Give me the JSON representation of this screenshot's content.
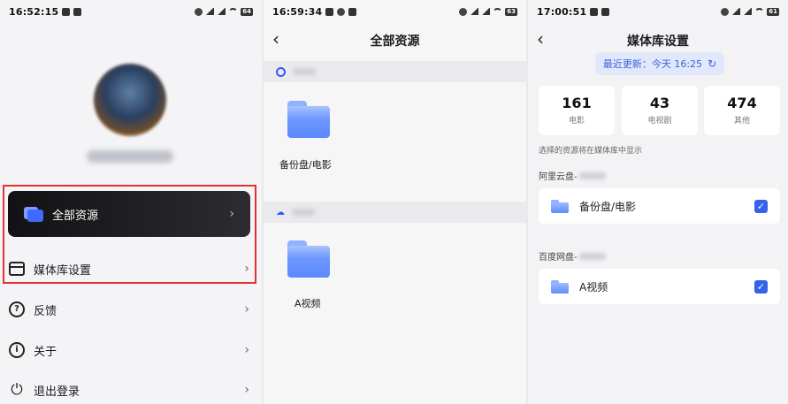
{
  "screen1": {
    "status_time": "16:52:15",
    "menu": {
      "all_resources": "全部资源",
      "library_settings": "媒体库设置",
      "feedback": "反馈",
      "about": "关于",
      "logout": "退出登录"
    },
    "icons": {
      "all_resources": "folder-icon",
      "library_settings": "calendar-icon",
      "feedback": "question-icon",
      "about": "info-icon",
      "logout": "power-icon"
    },
    "highlight_color": "#e23131"
  },
  "screen2": {
    "status_time": "16:59:34",
    "title": "全部资源",
    "folder1_label": "备份盘/电影",
    "folder2_label": "A视频"
  },
  "screen3": {
    "status_time": "17:00:51",
    "title": "媒体库设置",
    "last_update": "最近更新：今天 16:25",
    "stats": [
      {
        "num": "161",
        "label": "电影"
      },
      {
        "num": "43",
        "label": "电视剧"
      },
      {
        "num": "474",
        "label": "其他"
      }
    ],
    "hint": "选择的资源将在媒体库中显示",
    "group1_label": "阿里云盘-",
    "group1_item": "备份盘/电影",
    "group2_label": "百度网盘-",
    "group2_item": "A视频",
    "accent": "#3462e8"
  },
  "glyphs": {
    "chevron": "›",
    "back": "‹",
    "check": "✓",
    "refresh": "↻",
    "question": "?",
    "info": "i",
    "power": "⏻",
    "cloud": "☁"
  }
}
